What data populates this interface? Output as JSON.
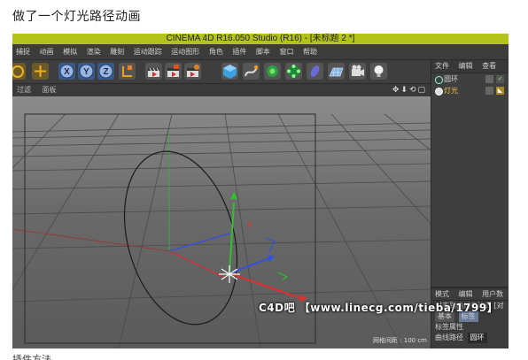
{
  "post": {
    "title": "做了一个灯光路径动画",
    "bottom_text": "插件方法"
  },
  "app": {
    "window_title": "CINEMA 4D R16.050 Studio (R16) - [未标题 2 *]",
    "menu": [
      "捕捉",
      "动画",
      "模拟",
      "渲染",
      "雕刻",
      "运动跟踪",
      "运动图形",
      "角色",
      "插件",
      "脚本",
      "窗口",
      "帮助"
    ],
    "toolbar_icons": [
      "rotate-tool-icon",
      "move-tool-icon",
      "x-axis-lock-icon",
      "y-axis-lock-icon",
      "z-axis-lock-icon",
      "coordinate-system-icon",
      "render-view-icon",
      "render-picture-queue-icon",
      "render-settings-icon",
      "cube-primitive-icon",
      "spline-pen-icon",
      "subdivision-nurbs-icon",
      "array-generator-icon",
      "deformer-icon",
      "floor-environment-icon",
      "camera-icon",
      "light-icon"
    ],
    "axis_letters": [
      "X",
      "Y",
      "Z"
    ]
  },
  "viewport": {
    "menus": [
      "过滤",
      "面板"
    ],
    "controls": "✥⬇⟲▢",
    "grid_spacing": "网格间距 : 100 cm"
  },
  "object_manager": {
    "tabs": [
      "文件",
      "编辑",
      "查看"
    ],
    "objects": [
      {
        "name": "圆环",
        "selected": false
      },
      {
        "name": "灯光",
        "selected": true
      }
    ]
  },
  "attribute_manager": {
    "tabs": [
      "模式",
      "编辑",
      "用户数"
    ],
    "tag_title": "对齐到曲线表达式 [对",
    "subtabs": [
      "基本",
      "标签"
    ],
    "section": "标签属性",
    "field_label": "曲线路径",
    "field_value": "圆环"
  },
  "watermark": "C4D吧 【www.linecg.com/tieba/1799】",
  "colors": {
    "titlebar": "#b4c21c",
    "x_axis": "#e03030",
    "y_axis": "#30c030",
    "z_axis": "#3050e0"
  }
}
